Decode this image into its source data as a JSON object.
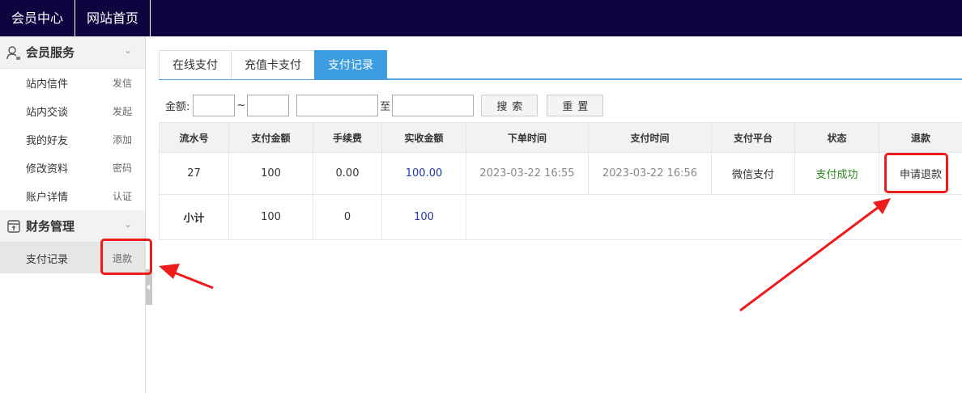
{
  "topnav": [
    "会员中心",
    "网站首页"
  ],
  "sidebar": {
    "groups": [
      {
        "title": "会员服务",
        "icon": "user-icon",
        "items": [
          {
            "label": "站内信件",
            "action": "发信"
          },
          {
            "label": "站内交谈",
            "action": "发起"
          },
          {
            "label": "我的好友",
            "action": "添加"
          },
          {
            "label": "修改资料",
            "action": "密码"
          },
          {
            "label": "账户详情",
            "action": "认证"
          }
        ]
      },
      {
        "title": "财务管理",
        "icon": "wallet-icon",
        "items": [
          {
            "label": "支付记录",
            "action": "退款"
          }
        ]
      }
    ]
  },
  "tabs": [
    "在线支付",
    "充值卡支付",
    "支付记录"
  ],
  "filter": {
    "amount_label": "金额:",
    "range_sep": "~",
    "date_sep": "至",
    "search_label": "搜索",
    "reset_label": "重置"
  },
  "table": {
    "headers": [
      "流水号",
      "支付金额",
      "手续费",
      "实收金额",
      "下单时间",
      "支付时间",
      "支付平台",
      "状态",
      "退款"
    ],
    "row": {
      "id": "27",
      "amount": "100",
      "fee": "0.00",
      "received": "100.00",
      "order_time": "2023-03-22 16:55",
      "pay_time": "2023-03-22 16:56",
      "platform": "微信支付",
      "status": "支付成功",
      "refund_action": "申请退款"
    },
    "summary": {
      "label": "小计",
      "amount": "100",
      "fee": "0",
      "received": "100"
    }
  },
  "colors": {
    "topbar": "#0c0540",
    "accent": "#3c9de0",
    "highlight": "#ee1b1b",
    "success": "#2a8a1a",
    "amount_blue": "#1e3aa8"
  }
}
